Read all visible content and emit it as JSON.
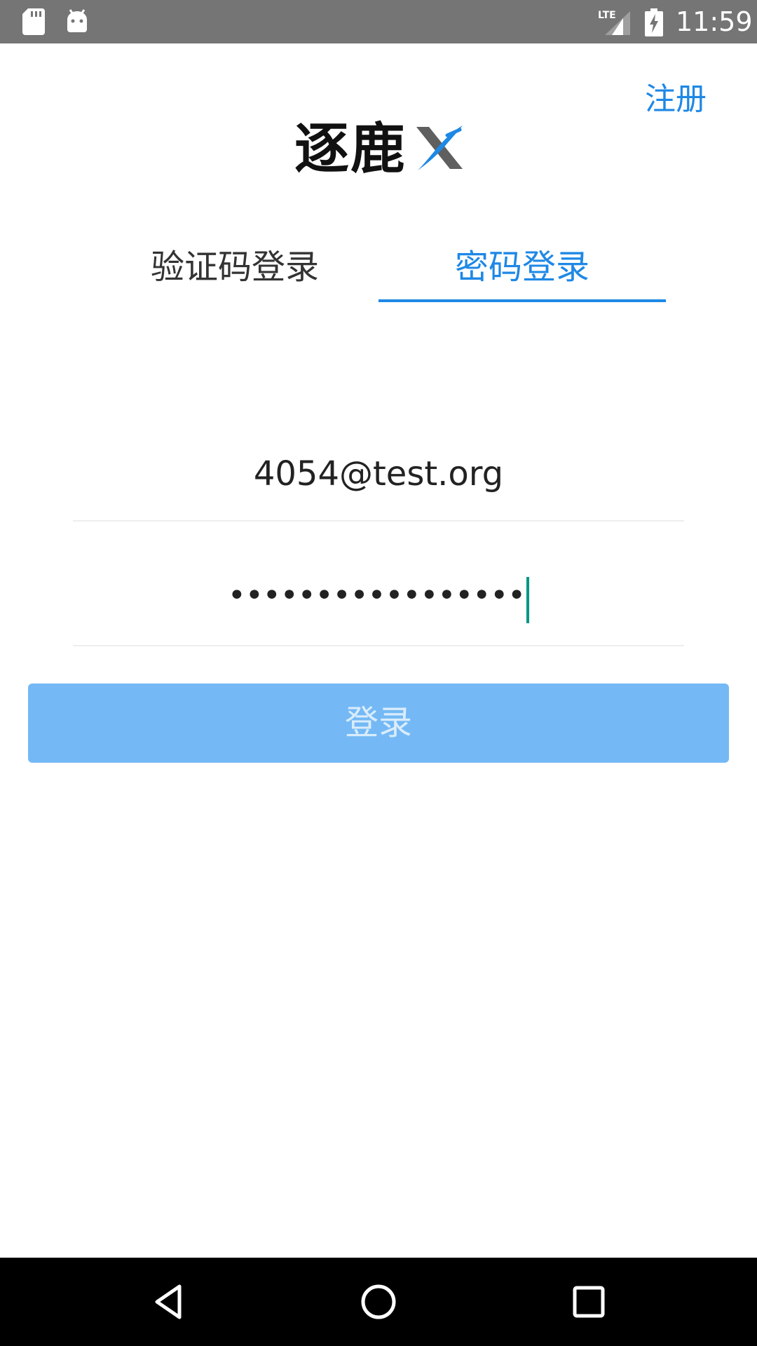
{
  "status_bar": {
    "time": "11:59",
    "network": "LTE",
    "icons": [
      "sd-card-icon",
      "android-icon",
      "lte-signal-icon",
      "battery-charging-icon"
    ]
  },
  "header": {
    "register_label": "注册",
    "logo_text": "逐鹿",
    "logo_mark": "x-logo-icon"
  },
  "tabs": [
    {
      "label": "验证码登录",
      "active": false
    },
    {
      "label": "密码登录",
      "active": true
    }
  ],
  "form": {
    "email_value": "4054@test.org",
    "password_value": "•••••••••••••••••",
    "login_label": "登录"
  },
  "nav_bar": {
    "icons": [
      "back-icon",
      "home-icon",
      "recents-icon"
    ]
  },
  "colors": {
    "accent": "#1E88E5",
    "button_disabled": "#74B9F5",
    "status_bar": "#757575",
    "caret": "#009688"
  }
}
